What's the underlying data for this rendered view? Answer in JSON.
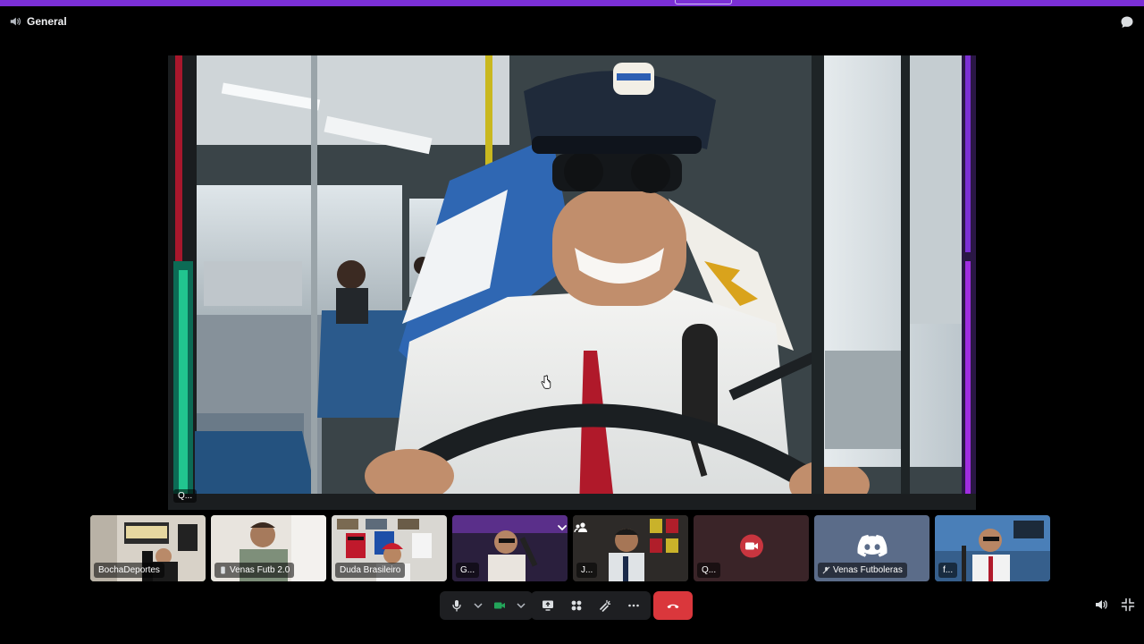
{
  "channel": {
    "name": "General",
    "icon": "speaker-icon"
  },
  "header": {
    "chat_icon": "chat-bubble-icon"
  },
  "main_stream": {
    "name_tag": "Q...",
    "description_icon": "stream-video"
  },
  "participants": [
    {
      "name": "BochaDeportes",
      "active": true
    },
    {
      "name": "Venas Futb 2.0",
      "active": true,
      "icon": "phone-icon"
    },
    {
      "name": "Duda Brasileiro",
      "active": false
    },
    {
      "name": "G...",
      "active": false
    },
    {
      "name": "J...",
      "active": false
    },
    {
      "name": "Q...",
      "active": false,
      "icon": "camera-icon"
    },
    {
      "name": "Venas Futboleras",
      "active": false,
      "icon": "mic-muted-icon"
    },
    {
      "name": "f...",
      "active": false
    }
  ],
  "controls": {
    "mic": "microphone-icon",
    "camera": "camera-icon",
    "screen_share": "screen-share-icon",
    "activities": "activities-icon",
    "soundboard": "soundboard-icon",
    "more": "more-icon",
    "hangup": "hangup-icon"
  },
  "colors": {
    "accent": "#7b2fd6",
    "active_border": "#4c8a52",
    "hangup": "#da373c",
    "camera_on": "#23a55a"
  }
}
